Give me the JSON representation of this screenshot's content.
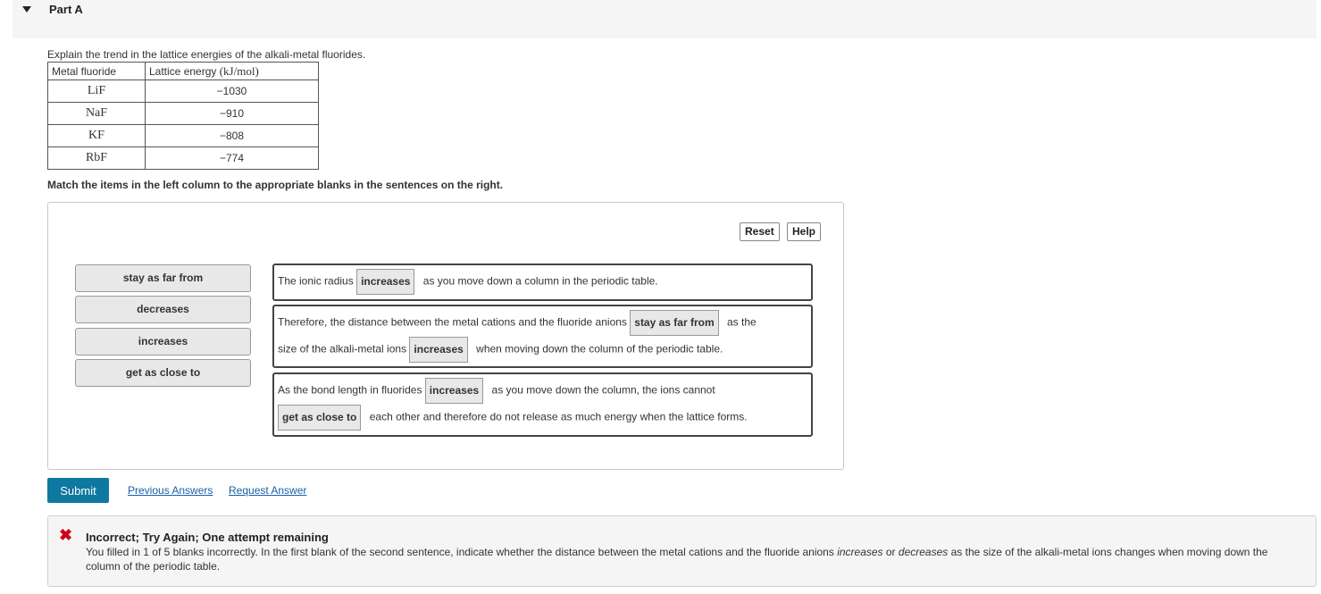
{
  "part": {
    "title": "Part A"
  },
  "question": {
    "prompt": "Explain the trend in the lattice energies of the alkali-metal fluorides.",
    "table": {
      "headers": [
        "Metal fluoride",
        "Lattice energy ",
        "(kJ/mol)"
      ],
      "rows": [
        {
          "formula": "LiF",
          "energy": "−1030"
        },
        {
          "formula": "NaF",
          "energy": "−910"
        },
        {
          "formula": "KF",
          "energy": "−808"
        },
        {
          "formula": "RbF",
          "energy": "−774"
        }
      ]
    },
    "instructions": "Match the items in the left column to the appropriate blanks in the sentences on the right."
  },
  "toolbar": {
    "reset_label": "Reset",
    "help_label": "Help"
  },
  "source_items": [
    "stay as far from",
    "decreases",
    "increases",
    "get as close to"
  ],
  "sentences": {
    "s1": {
      "before": "The ionic radius",
      "blank": "increases",
      "after": "as you move down a column in the periodic table."
    },
    "s2": {
      "before": "Therefore, the distance between the metal cations and the fluoride anions",
      "blank1": "stay as far from",
      "after1": "as the",
      "before2": "size of the alkali-metal ions",
      "blank2": "increases",
      "after2": "when moving down the column of the periodic table."
    },
    "s3": {
      "before": "As the bond length in fluorides",
      "blank1": "increases",
      "after1": "as you move down the column, the ions cannot",
      "blank2": "get as close to",
      "after2": "each other and therefore do not release as much energy when the lattice forms."
    }
  },
  "actions": {
    "submit_label": "Submit",
    "previous_answers_label": "Previous Answers",
    "request_answer_label": "Request Answer"
  },
  "feedback": {
    "title": "Incorrect; Try Again; One attempt remaining",
    "text_part1": "You filled in 1 of 5 blanks incorrectly. In the first blank of the second sentence, indicate whether the distance between the metal cations and the fluoride anions ",
    "em1": "increases",
    "text_part2": " or ",
    "em2": "decreases",
    "text_part3": " as the size of the alkali-metal ions changes when moving down the column of the periodic table.",
    "icon_color": "#d0021b"
  },
  "colors": {
    "submit_bg": "#0f78a0",
    "link": "#1a5fa8"
  }
}
